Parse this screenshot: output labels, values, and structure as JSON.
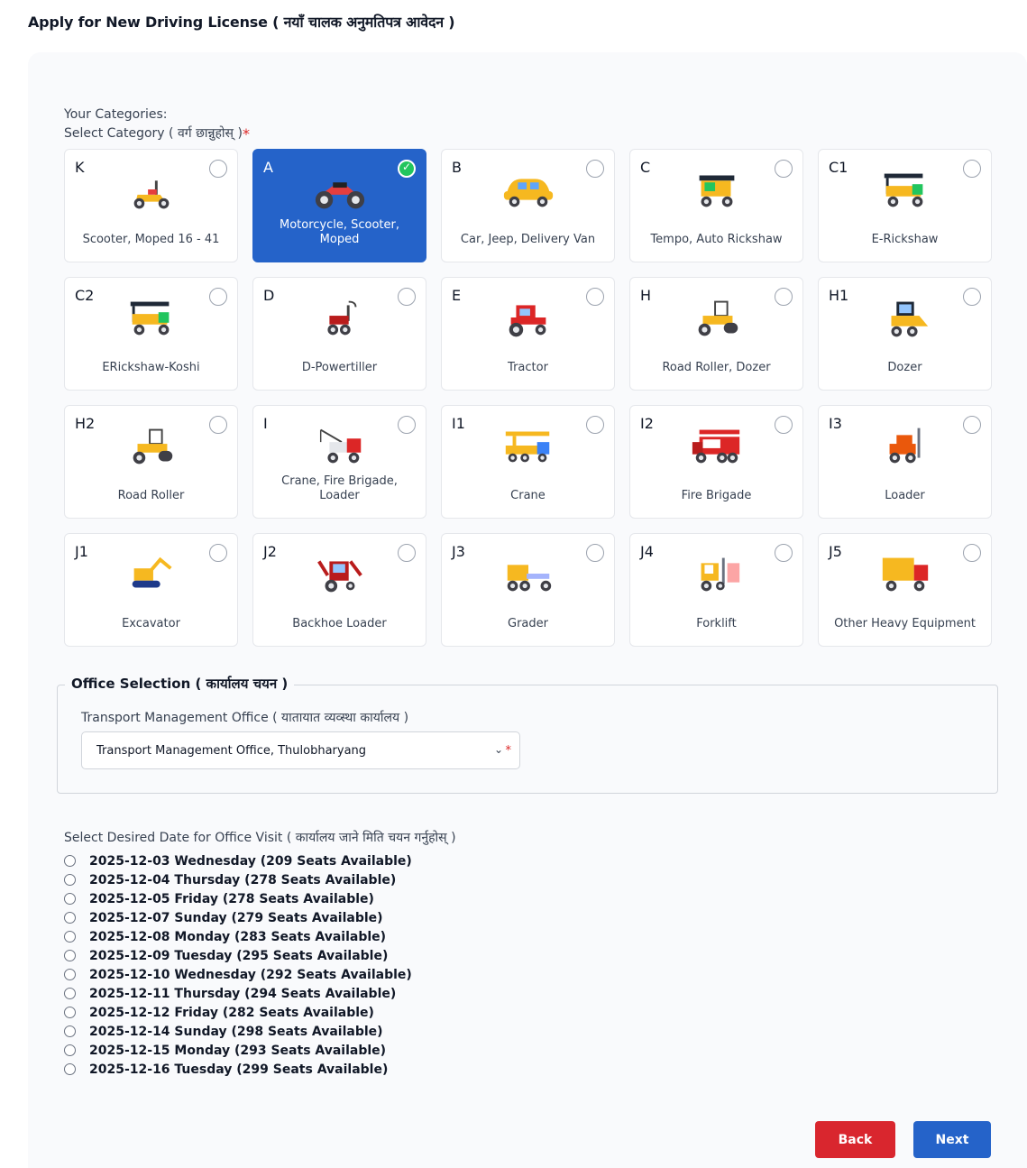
{
  "page": {
    "title": "Apply for New Driving License ( नयाँ चालक अनुमतिपत्र आवेदन )"
  },
  "category": {
    "heading_line1": "Your Categories:",
    "heading_line2": "Select Category ( वर्ग छान्नुहोस् )",
    "required_mark": "*",
    "selected_code": "A",
    "items": [
      {
        "code": "K",
        "label": "Scooter, Moped 16 - 41",
        "icon": "scooter-icon",
        "selected": false
      },
      {
        "code": "A",
        "label": "Motorcycle, Scooter, Moped",
        "icon": "motorcycle-icon",
        "selected": true
      },
      {
        "code": "B",
        "label": "Car, Jeep, Delivery Van",
        "icon": "car-icon",
        "selected": false
      },
      {
        "code": "C",
        "label": "Tempo, Auto Rickshaw",
        "icon": "auto-rickshaw-icon",
        "selected": false
      },
      {
        "code": "C1",
        "label": "E-Rickshaw",
        "icon": "e-rickshaw-icon",
        "selected": false
      },
      {
        "code": "C2",
        "label": "ERickshaw-Koshi",
        "icon": "e-rickshaw-koshi-icon",
        "selected": false
      },
      {
        "code": "D",
        "label": "D-Powertiller",
        "icon": "powertiller-icon",
        "selected": false
      },
      {
        "code": "E",
        "label": "Tractor",
        "icon": "tractor-icon",
        "selected": false
      },
      {
        "code": "H",
        "label": "Road Roller, Dozer",
        "icon": "road-roller-dozer-icon",
        "selected": false
      },
      {
        "code": "H1",
        "label": "Dozer",
        "icon": "dozer-icon",
        "selected": false
      },
      {
        "code": "H2",
        "label": "Road Roller",
        "icon": "road-roller-icon",
        "selected": false
      },
      {
        "code": "I",
        "label": "Crane, Fire Brigade, Loader",
        "icon": "tow-crane-icon",
        "selected": false
      },
      {
        "code": "I1",
        "label": "Crane",
        "icon": "crane-icon",
        "selected": false
      },
      {
        "code": "I2",
        "label": "Fire Brigade",
        "icon": "fire-truck-icon",
        "selected": false
      },
      {
        "code": "I3",
        "label": "Loader",
        "icon": "loader-icon",
        "selected": false
      },
      {
        "code": "J1",
        "label": "Excavator",
        "icon": "excavator-icon",
        "selected": false
      },
      {
        "code": "J2",
        "label": "Backhoe Loader",
        "icon": "backhoe-loader-icon",
        "selected": false
      },
      {
        "code": "J3",
        "label": "Grader",
        "icon": "grader-icon",
        "selected": false
      },
      {
        "code": "J4",
        "label": "Forklift",
        "icon": "forklift-icon",
        "selected": false
      },
      {
        "code": "J5",
        "label": "Other Heavy Equipment",
        "icon": "heavy-truck-icon",
        "selected": false
      }
    ]
  },
  "office": {
    "legend": "Office Selection ( कार्यालय चयन )",
    "field_label": "Transport Management Office ( यातायात व्यव्स्था कार्यालय )",
    "selected_value": "Transport Management Office, Thulobharyang",
    "required_mark": "*"
  },
  "visit_date": {
    "heading": "Select Desired Date for Office Visit ( कार्यालय जाने मिति चयन गर्नुहोस् )",
    "options": [
      "2025-12-03 Wednesday (209 Seats Available)",
      "2025-12-04 Thursday (278 Seats Available)",
      "2025-12-05 Friday (278 Seats Available)",
      "2025-12-07 Sunday (279 Seats Available)",
      "2025-12-08 Monday (283 Seats Available)",
      "2025-12-09 Tuesday (295 Seats Available)",
      "2025-12-10 Wednesday (292 Seats Available)",
      "2025-12-11 Thursday (294 Seats Available)",
      "2025-12-12 Friday (282 Seats Available)",
      "2025-12-14 Sunday (298 Seats Available)",
      "2025-12-15 Monday (293 Seats Available)",
      "2025-12-16 Tuesday (299 Seats Available)"
    ]
  },
  "actions": {
    "back_label": "Back",
    "next_label": "Next"
  },
  "colors": {
    "primary": "#2563c9",
    "danger": "#d9262e",
    "check": "#22c55e",
    "vehicle_yellow": "#f6b820"
  }
}
